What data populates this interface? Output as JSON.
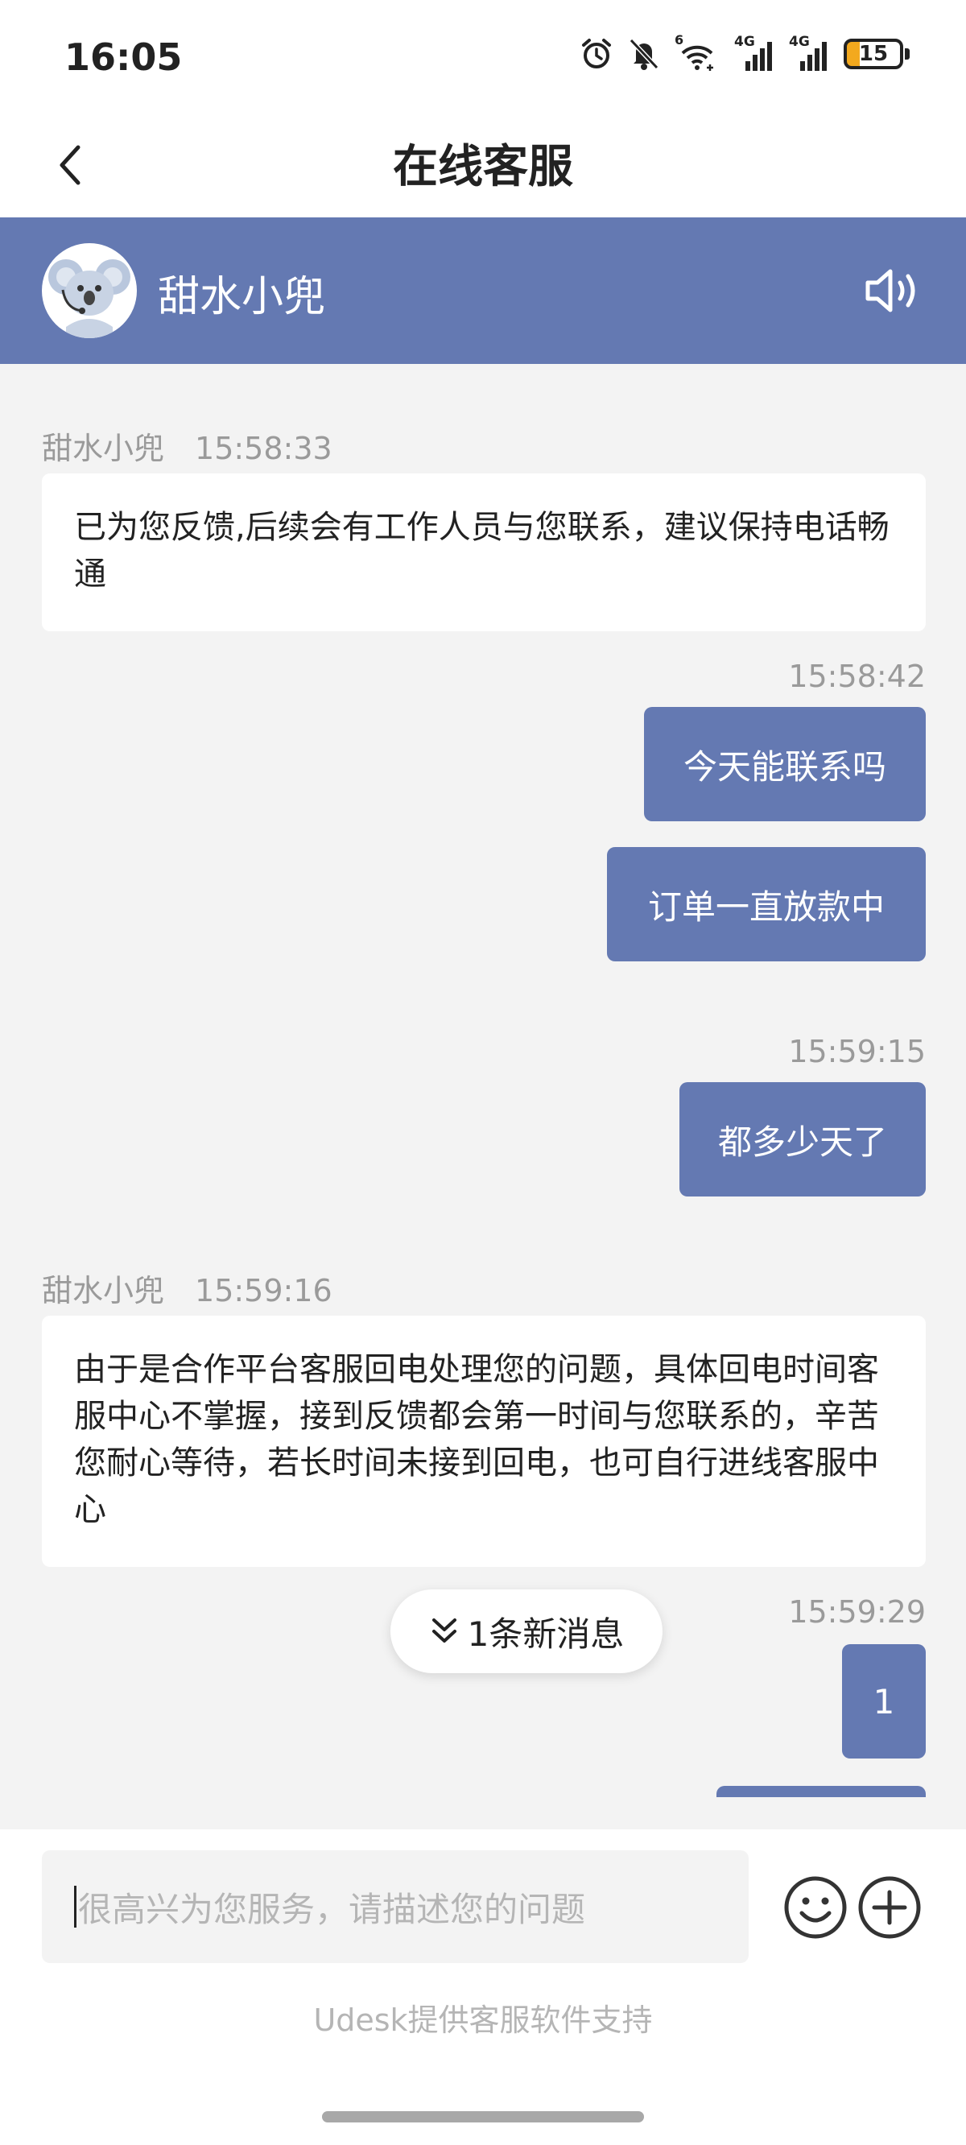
{
  "status_bar": {
    "time": "16:05",
    "icons": [
      "alarm-icon",
      "mute-bell-icon",
      "wifi6-icon",
      "signal-4g-icon",
      "signal-4g-icon-2"
    ],
    "wifi_badge": "6",
    "network_1": "4G",
    "network_2": "4G",
    "battery": "15"
  },
  "nav": {
    "title": "在线客服",
    "back_icon": "chevron-left-icon"
  },
  "agent": {
    "name": "甜水小兜",
    "avatar_icon": "koala-avatar-icon",
    "speaker_icon": "speaker-icon"
  },
  "messages": [
    {
      "type": "incoming",
      "sender": "甜水小兜",
      "time": "15:58:33",
      "text": "已为您反馈,后续会有工作人员与您联系，建议保持电话畅通"
    },
    {
      "type": "outgoing",
      "time": "15:58:42",
      "text": "今天能联系吗"
    },
    {
      "type": "outgoing",
      "text": "订单一直放款中"
    },
    {
      "type": "outgoing",
      "time": "15:59:15",
      "text": "都多少天了"
    },
    {
      "type": "incoming",
      "sender": "甜水小兜",
      "time": "15:59:16",
      "text": "由于是合作平台客服回电处理您的问题，具体回电时间客服中心不掌握，接到反馈都会第一时间与您联系的，辛苦您耐心等待，若长时间未接到回电，也可自行进线客服中心"
    },
    {
      "type": "outgoing",
      "time": "15:59:29",
      "text": "1"
    }
  ],
  "new_messages": {
    "label": "1条新消息",
    "icon": "double-chevron-down-icon"
  },
  "composer": {
    "placeholder": "很高兴为您服务，请描述您的问题",
    "emoji_icon": "emoji-icon",
    "plus_icon": "plus-circle-icon"
  },
  "footer": {
    "powered_by": "Udesk提供客服软件支持"
  },
  "colors": {
    "accent": "#6479b2",
    "background": "#f3f3f3",
    "bubble_incoming": "#ffffff",
    "battery_low": "#f3a91e"
  }
}
